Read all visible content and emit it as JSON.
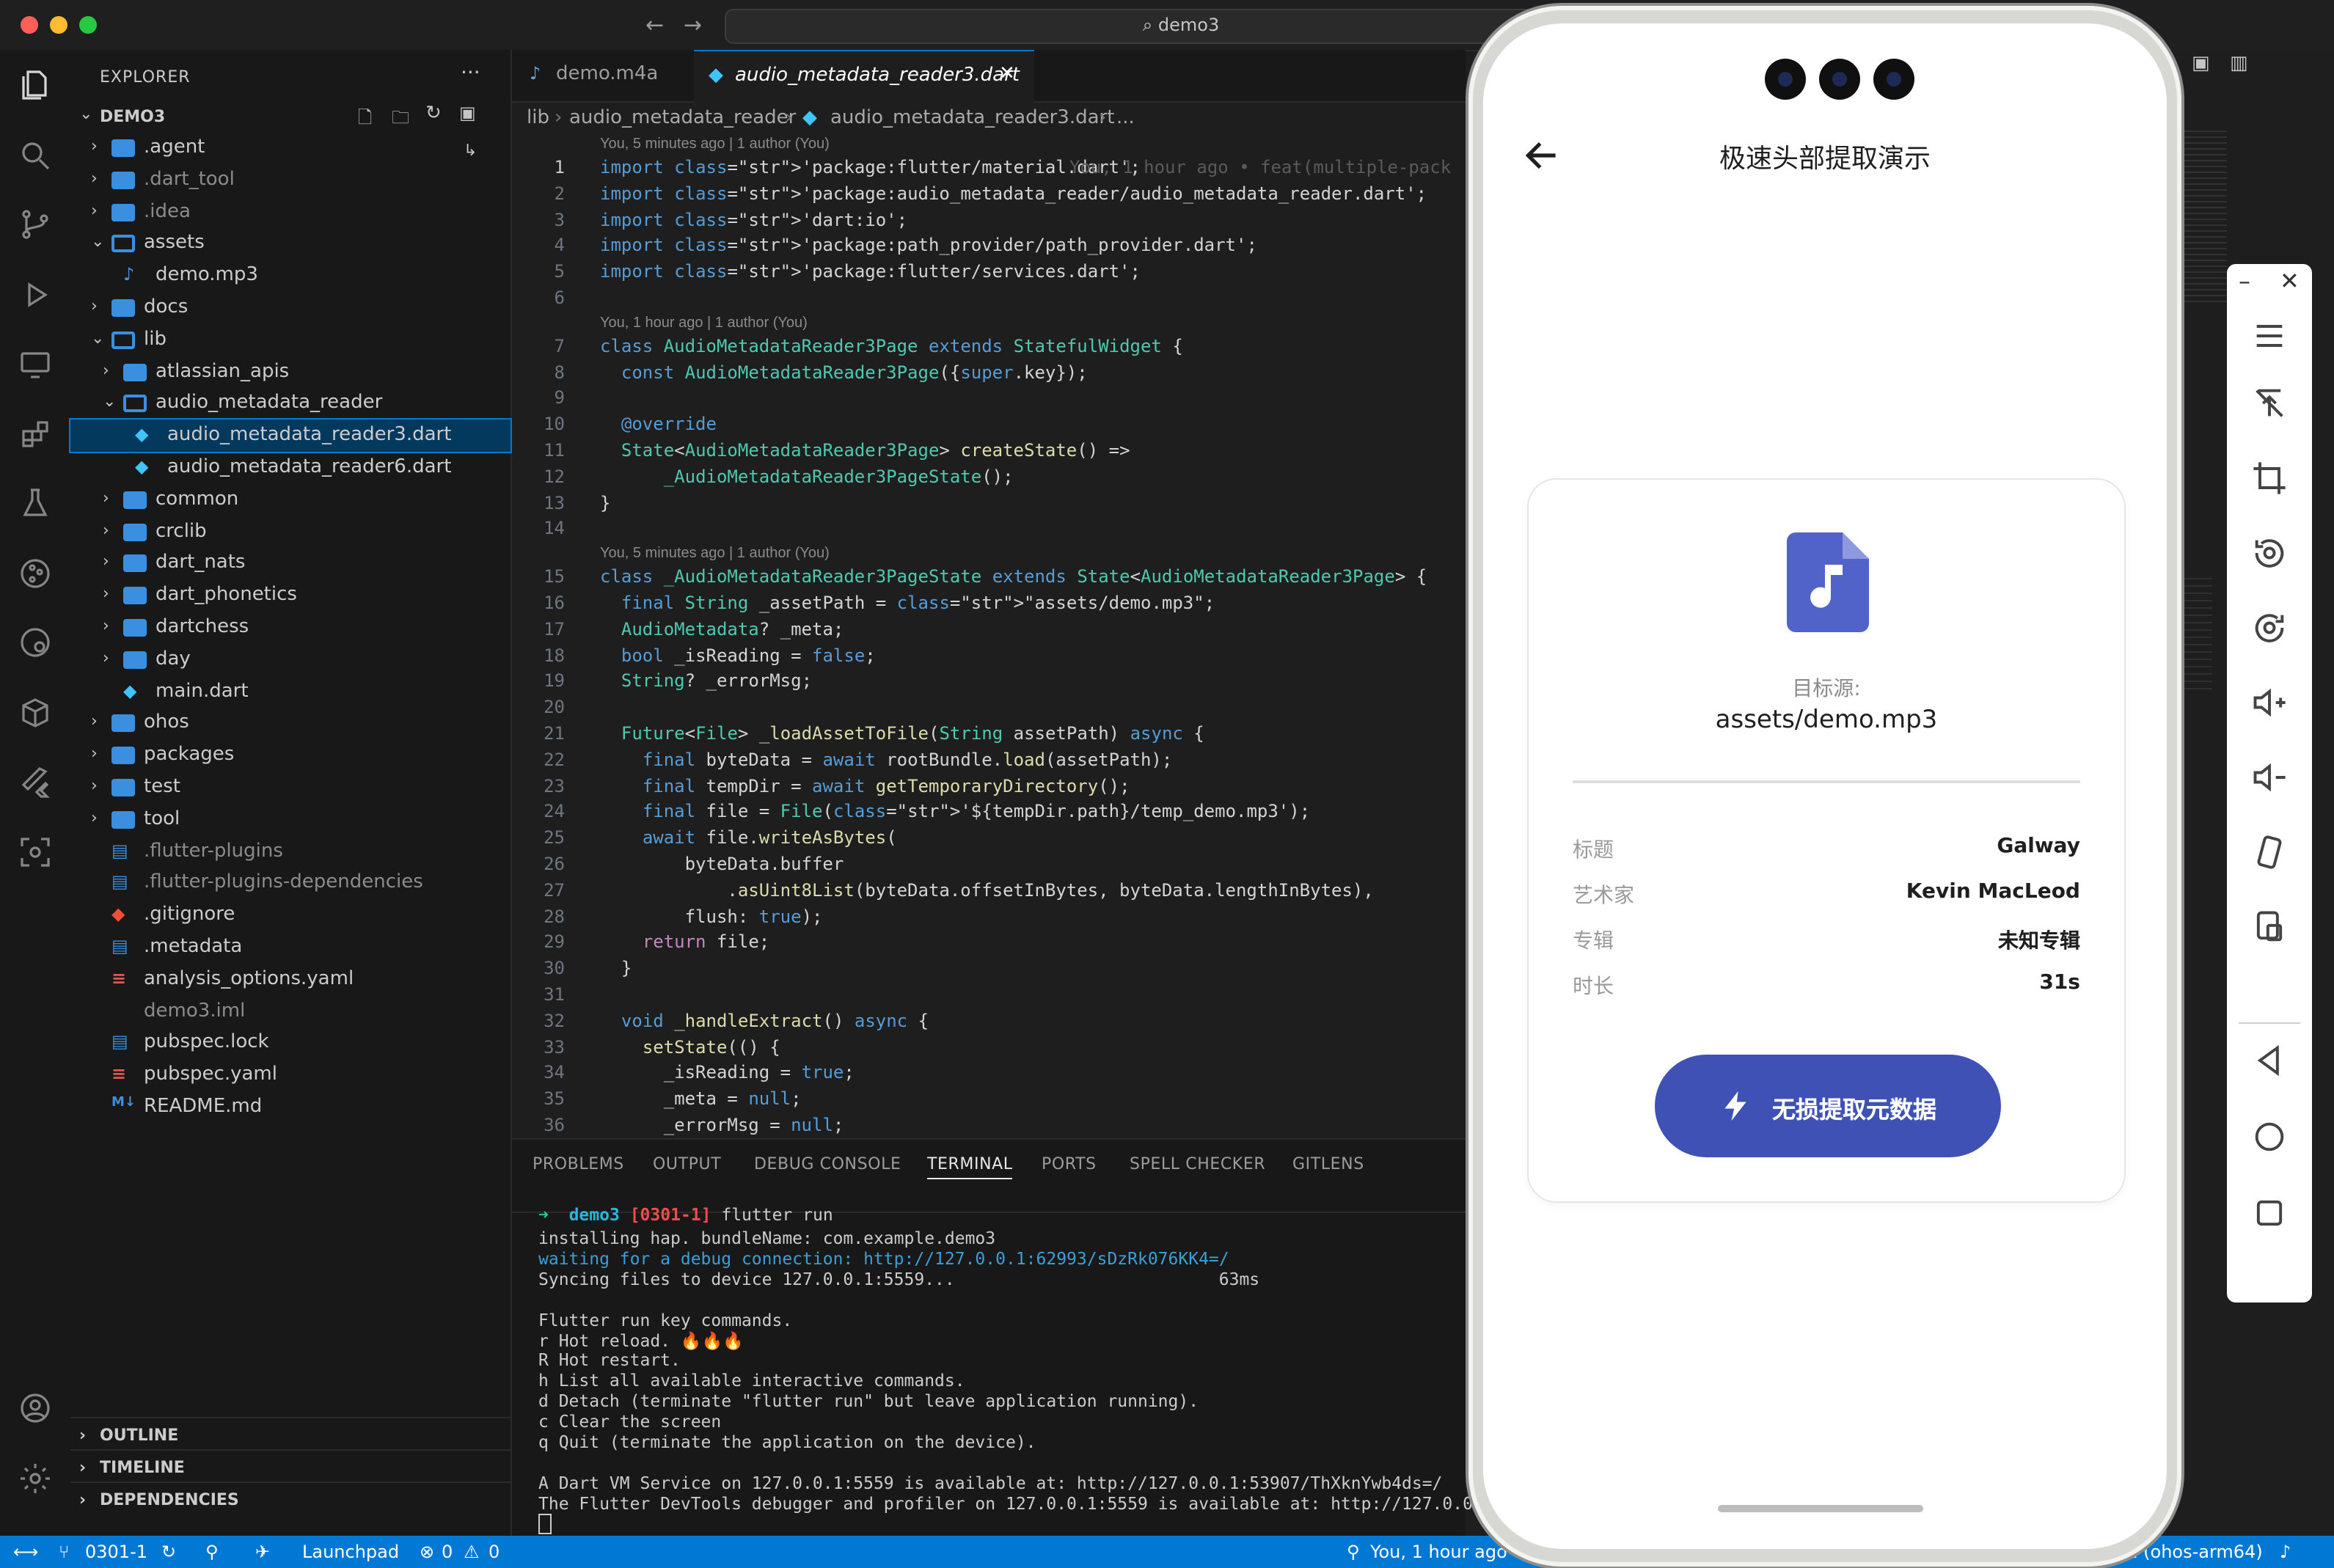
{
  "window": {
    "search_text": "demo3"
  },
  "explorer": {
    "title": "EXPLORER",
    "project": "DEMO3",
    "items": [
      {
        "label": ".agent",
        "kind": "folder",
        "depth": 0
      },
      {
        "label": ".dart_tool",
        "kind": "folder",
        "depth": 0
      },
      {
        "label": ".idea",
        "kind": "folder",
        "depth": 0
      },
      {
        "label": "assets",
        "kind": "folder-open",
        "depth": 0
      },
      {
        "label": "demo.mp3",
        "kind": "audio",
        "depth": 1
      },
      {
        "label": "docs",
        "kind": "folder",
        "depth": 0
      },
      {
        "label": "lib",
        "kind": "folder-open",
        "depth": 0
      },
      {
        "label": "atlassian_apis",
        "kind": "folder",
        "depth": 1
      },
      {
        "label": "audio_metadata_reader",
        "kind": "folder-open",
        "depth": 1
      },
      {
        "label": "audio_metadata_reader3.dart",
        "kind": "dart",
        "depth": 2
      },
      {
        "label": "audio_metadata_reader6.dart",
        "kind": "dart",
        "depth": 2
      },
      {
        "label": "common",
        "kind": "folder",
        "depth": 1
      },
      {
        "label": "crclib",
        "kind": "folder",
        "depth": 1
      },
      {
        "label": "dart_nats",
        "kind": "folder",
        "depth": 1
      },
      {
        "label": "dart_phonetics",
        "kind": "folder",
        "depth": 1
      },
      {
        "label": "dartchess",
        "kind": "folder",
        "depth": 1
      },
      {
        "label": "day",
        "kind": "folder",
        "depth": 1
      },
      {
        "label": "main.dart",
        "kind": "dart",
        "depth": 1
      },
      {
        "label": "ohos",
        "kind": "folder",
        "depth": 0
      },
      {
        "label": "packages",
        "kind": "folder",
        "depth": 0
      },
      {
        "label": "test",
        "kind": "folder",
        "depth": 0
      },
      {
        "label": "tool",
        "kind": "folder",
        "depth": 0
      },
      {
        "label": ".flutter-plugins",
        "kind": "file-dim",
        "depth": 0
      },
      {
        "label": ".flutter-plugins-dependencies",
        "kind": "file-dim",
        "depth": 0
      },
      {
        "label": ".gitignore",
        "kind": "git",
        "depth": 0
      },
      {
        "label": ".metadata",
        "kind": "file",
        "depth": 0
      },
      {
        "label": "analysis_options.yaml",
        "kind": "yaml",
        "depth": 0
      },
      {
        "label": "demo3.iml",
        "kind": "xml-dim",
        "depth": 0
      },
      {
        "label": "pubspec.lock",
        "kind": "file",
        "depth": 0
      },
      {
        "label": "pubspec.yaml",
        "kind": "yaml",
        "depth": 0
      },
      {
        "label": "README.md",
        "kind": "md",
        "depth": 0
      }
    ],
    "sections": [
      "OUTLINE",
      "TIMELINE",
      "DEPENDENCIES"
    ]
  },
  "editor": {
    "tabs": [
      {
        "label": "demo.m4a",
        "active": false
      },
      {
        "label": "audio_metadata_reader3.dart",
        "active": true
      }
    ],
    "breadcrumb": [
      "lib",
      "audio_metadata_reader",
      "audio_metadata_reader3.dart",
      "..."
    ],
    "blame": [
      "You, 5 minutes ago | 1 author (You)",
      "You, 1 hour ago | 1 author (You)",
      "You, 5 minutes ago | 1 author (You)"
    ],
    "inline_blame": "You, 1 hour ago • feat(multiple-pack",
    "lines": [
      "import 'package:flutter/material.dart';",
      "import 'package:audio_metadata_reader/audio_metadata_reader.dart';",
      "import 'dart:io';",
      "import 'package:path_provider/path_provider.dart';",
      "import 'package:flutter/services.dart';",
      "",
      "class AudioMetadataReader3Page extends StatefulWidget {",
      "  const AudioMetadataReader3Page({super.key});",
      "",
      "  @override",
      "  State<AudioMetadataReader3Page> createState() =>",
      "      _AudioMetadataReader3PageState();",
      "}",
      "",
      "class _AudioMetadataReader3PageState extends State<AudioMetadataReader3Page> {",
      "  final String _assetPath = \"assets/demo.mp3\";",
      "  AudioMetadata? _meta;",
      "  bool _isReading = false;",
      "  String? _errorMsg;",
      "",
      "  Future<File> _loadAssetToFile(String assetPath) async {",
      "    final byteData = await rootBundle.load(assetPath);",
      "    final tempDir = await getTemporaryDirectory();",
      "    final file = File('${tempDir.path}/temp_demo.mp3');",
      "    await file.writeAsBytes(",
      "        byteData.buffer",
      "            .asUint8List(byteData.offsetInBytes, byteData.lengthInBytes),",
      "        flush: true);",
      "    return file;",
      "  }",
      "",
      "  void _handleExtract() async {",
      "    setState(() {",
      "      _isReading = true;",
      "      _meta = null;",
      "      _errorMsg = null;"
    ]
  },
  "panel": {
    "tabs": [
      "PROBLEMS",
      "OUTPUT",
      "DEBUG CONSOLE",
      "TERMINAL",
      "PORTS",
      "SPELL CHECKER",
      "GITLENS"
    ],
    "active_tab": "TERMINAL",
    "prompt_dir": "demo3",
    "prompt_branch": "[0301-1]",
    "prompt_cmd": "flutter run",
    "terminal_lines": [
      "installing hap. bundleName: com.example.demo3",
      "waiting for a debug connection: http://127.0.0.1:62993/sDzRk076KK4=/",
      "Syncing files to device 127.0.0.1:5559...                          63ms",
      "",
      "Flutter run key commands.",
      "r Hot reload. 🔥🔥🔥",
      "R Hot restart.",
      "h List all available interactive commands.",
      "d Detach (terminate \"flutter run\" but leave application running).",
      "c Clear the screen",
      "q Quit (terminate the application on the device).",
      "",
      "A Dart VM Service on 127.0.0.1:5559 is available at: http://127.0.0.1:53907/ThXknYwb4ds=/",
      "The Flutter DevTools debugger and profiler on 127.0.0.1:5559 is available at: http://127.0.0"
    ]
  },
  "statusbar": {
    "branch": "0301-1",
    "launchpad": "Launchpad",
    "errors": "0",
    "warnings": "0",
    "blame": "You, 1 hour ago",
    "device": "01 (ohos-arm64)"
  },
  "phone": {
    "title": "极速头部提取演示",
    "source_label": "目标源:",
    "source_value": "assets/demo.mp3",
    "meta": [
      {
        "key": "标题",
        "value": "Galway"
      },
      {
        "key": "艺术家",
        "value": "Kevin MacLeod"
      },
      {
        "key": "专辑",
        "value": "未知专辑"
      },
      {
        "key": "时长",
        "value": "31s"
      }
    ],
    "button": "无损提取元数据",
    "accent": "#3f51b5"
  },
  "colors": {
    "accent": "#0078d4",
    "folder": "#3b8fe0",
    "dart": "#40c4ff"
  }
}
